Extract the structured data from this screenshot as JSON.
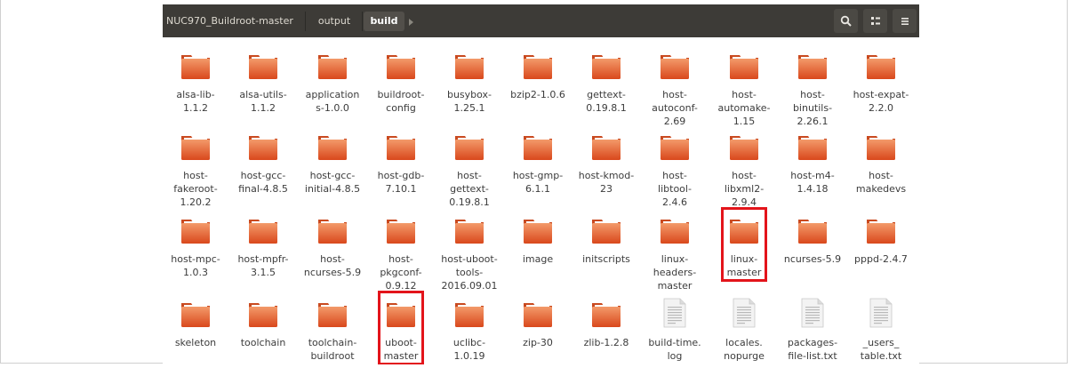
{
  "toolbar": {
    "breadcrumbs": [
      "NUC970_Buildroot-master",
      "output",
      "build"
    ],
    "search_icon": "search-icon",
    "view_icon": "view-options-icon",
    "menu_icon": "hamburger-menu-icon"
  },
  "items": [
    {
      "name": "alsa-lib-\n1.1.2",
      "type": "folder"
    },
    {
      "name": "alsa-utils-\n1.1.2",
      "type": "folder"
    },
    {
      "name": "application\ns-1.0.0",
      "type": "folder"
    },
    {
      "name": "buildroot-\nconfig",
      "type": "folder"
    },
    {
      "name": "busybox-\n1.25.1",
      "type": "folder"
    },
    {
      "name": "bzip2-1.0.6",
      "type": "folder"
    },
    {
      "name": "gettext-\n0.19.8.1",
      "type": "folder"
    },
    {
      "name": "host-\nautoconf-\n2.69",
      "type": "folder"
    },
    {
      "name": "host-\nautomake-\n1.15",
      "type": "folder"
    },
    {
      "name": "host-\nbinutils-\n2.26.1",
      "type": "folder"
    },
    {
      "name": "host-expat-\n2.2.0",
      "type": "folder"
    },
    {
      "name": "host-\nfakeroot-\n1.20.2",
      "type": "folder"
    },
    {
      "name": "host-gcc-\nfinal-4.8.5",
      "type": "folder"
    },
    {
      "name": "host-gcc-\ninitial-4.8.5",
      "type": "folder"
    },
    {
      "name": "host-gdb-\n7.10.1",
      "type": "folder"
    },
    {
      "name": "host-\ngettext-\n0.19.8.1",
      "type": "folder"
    },
    {
      "name": "host-gmp-\n6.1.1",
      "type": "folder"
    },
    {
      "name": "host-kmod-\n23",
      "type": "folder"
    },
    {
      "name": "host-\nlibtool-\n2.4.6",
      "type": "folder"
    },
    {
      "name": "host-\nlibxml2-\n2.9.4",
      "type": "folder"
    },
    {
      "name": "host-m4-\n1.4.18",
      "type": "folder"
    },
    {
      "name": "host-\nmakedevs",
      "type": "folder"
    },
    {
      "name": "host-mpc-\n1.0.3",
      "type": "folder"
    },
    {
      "name": "host-mpfr-\n3.1.5",
      "type": "folder"
    },
    {
      "name": "host-\nncurses-5.9",
      "type": "folder"
    },
    {
      "name": "host-\npkgconf-\n0.9.12",
      "type": "folder"
    },
    {
      "name": "host-uboot-\ntools-\n2016.09.01",
      "type": "folder"
    },
    {
      "name": "image",
      "type": "folder"
    },
    {
      "name": "initscripts",
      "type": "folder"
    },
    {
      "name": "linux-\nheaders-\nmaster",
      "type": "folder"
    },
    {
      "name": "linux-\nmaster",
      "type": "folder",
      "highlighted": true
    },
    {
      "name": "ncurses-5.9",
      "type": "folder"
    },
    {
      "name": "pppd-2.4.7",
      "type": "folder"
    },
    {
      "name": "skeleton",
      "type": "folder"
    },
    {
      "name": "toolchain",
      "type": "folder"
    },
    {
      "name": "toolchain-\nbuildroot",
      "type": "folder"
    },
    {
      "name": "uboot-\nmaster",
      "type": "folder",
      "highlighted": true
    },
    {
      "name": "uclibc-\n1.0.19",
      "type": "folder"
    },
    {
      "name": "zip-30",
      "type": "folder"
    },
    {
      "name": "zlib-1.2.8",
      "type": "folder"
    },
    {
      "name": "build-time.\nlog",
      "type": "file"
    },
    {
      "name": "locales.\nnopurge",
      "type": "file"
    },
    {
      "name": "packages-\nfile-list.txt",
      "type": "file"
    },
    {
      "name": "_users_\ntable.txt",
      "type": "file"
    }
  ],
  "colors": {
    "toolbar_bg": "#3d3b37",
    "folder_orange": "#e8592a",
    "folder_light": "#f39a6a",
    "highlight_red": "#e3141b"
  }
}
